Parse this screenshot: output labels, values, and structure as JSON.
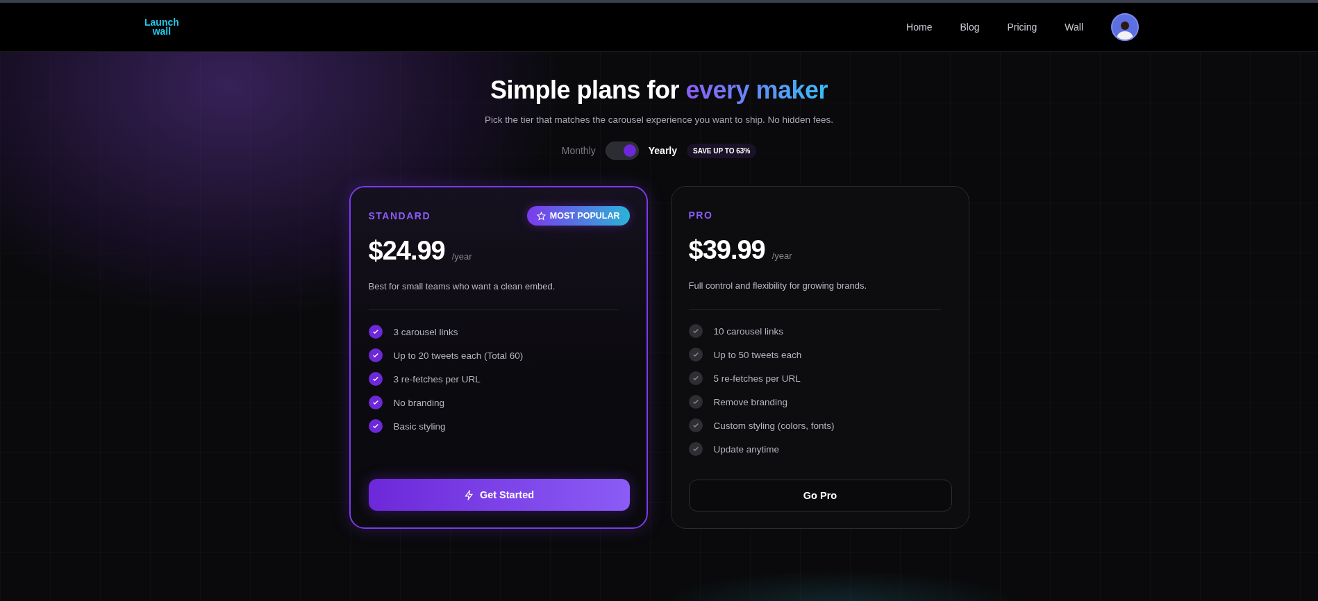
{
  "header": {
    "logo": [
      "Launch",
      "wall"
    ],
    "nav": [
      {
        "label": "Home"
      },
      {
        "label": "Blog"
      },
      {
        "label": "Pricing"
      },
      {
        "label": "Wall"
      }
    ]
  },
  "hero": {
    "title": "Simple plans for ",
    "title_highlight": "every maker",
    "subtitle": "Pick the tier that matches the carousel experience you want to ship. No hidden fees."
  },
  "billing": {
    "options": [
      {
        "label": "Monthly",
        "selected": false
      },
      {
        "label": "Yearly",
        "selected": true
      }
    ],
    "badge": "SAVE UP TO 63%"
  },
  "plans": [
    {
      "name": "STANDARD",
      "featured": true,
      "badge": "MOST POPULAR",
      "price": "$24.99",
      "period": "/year",
      "description": "Best for small teams who want a clean embed.",
      "features": [
        "3 carousel links",
        "Up to 20 tweets each (Total 60)",
        "3 re-fetches per URL",
        "No branding",
        "Basic styling"
      ],
      "button": {
        "kind": "primary",
        "label": "Get Started"
      }
    },
    {
      "name": "PRO",
      "featured": false,
      "price": "$39.99",
      "period": "/year",
      "description": "Full control and flexibility for growing brands.",
      "features": [
        "10 carousel links",
        "Up to 50 tweets each",
        "5 re-fetches per URL",
        "Remove branding",
        "Custom styling (colors, fonts)",
        "Update anytime"
      ],
      "button": {
        "kind": "outline",
        "label": "Go Pro"
      }
    }
  ]
}
